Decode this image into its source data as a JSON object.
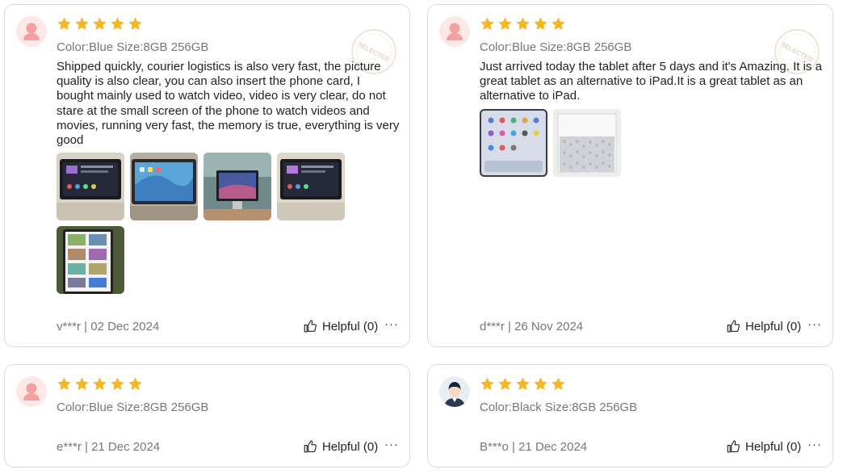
{
  "colors": {
    "star": "#f5b81e",
    "avatar_bg": "#fde8e8",
    "avatar_figure": "#f4a0a0",
    "muted": "#777777"
  },
  "reviews": [
    {
      "rating": 5,
      "variant": "Color:Blue Size:8GB 256GB",
      "text": "Shipped quickly, courier logistics is also very fast, the picture quality is also clear, you can also insert the phone card, I bought mainly used to watch video, video is very clear, do not stare at the small screen of the phone to watch videos and movies, running very fast, the memory is true, everything is very good",
      "stamp": "SELECTED",
      "author_date": "v***r | 02 Dec 2024",
      "helpful_label": "Helpful (0)",
      "more_label": "···",
      "photos": [
        "tablet-home-screen-photo",
        "tablet-blue-wallpaper-photo",
        "tablet-on-stand-photo",
        "tablet-home-screen-photo-2",
        "tablet-browser-photo"
      ]
    },
    {
      "rating": 5,
      "variant": "Color:Blue Size:8GB 256GB",
      "text": "Just arrived today the tablet after 5 days and it's Amazing. It is a great tablet as an alternative to iPad.It is a great tablet as an alternative to iPad.",
      "stamp": "SELECTED",
      "author_date": "d***r | 26 Nov 2024",
      "helpful_label": "Helpful (0)",
      "more_label": "···",
      "photos": [
        "tablet-app-grid-photo",
        "tablet-packaging-photo"
      ]
    },
    {
      "rating": 5,
      "variant": "Color:Blue Size:8GB 256GB",
      "author_date": "e***r | 21 Dec 2024",
      "helpful_label": "Helpful (0)",
      "more_label": "···"
    },
    {
      "rating": 5,
      "variant": "Color:Black Size:8GB 256GB",
      "author_date": "B***o | 21 Dec 2024",
      "helpful_label": "Helpful (0)",
      "more_label": "···"
    }
  ]
}
